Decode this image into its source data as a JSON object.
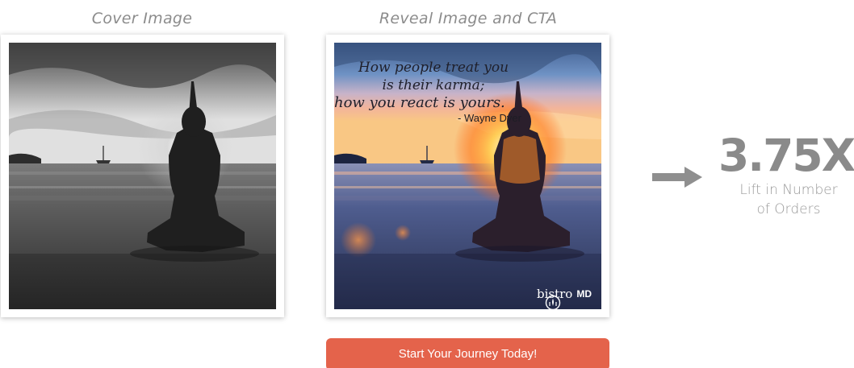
{
  "captions": {
    "cover": "Cover Image",
    "reveal": "Reveal Image and CTA"
  },
  "quote": {
    "line1": "How people treat you",
    "line2": "is their karma;",
    "line3": "how you react is yours.",
    "author": "- Wayne Dyer"
  },
  "brand": {
    "name_prefix": "bistro",
    "name_suffix": "MD",
    "icon": "bistromd-logo-icon"
  },
  "cta": {
    "label": "Start Your Journey Today!",
    "color": "#e4634b"
  },
  "metric": {
    "value": "3.75X",
    "label_line1": "Lift in Number",
    "label_line2": "of Orders",
    "color": "#8a8a8a"
  },
  "arrow": {
    "icon": "arrow-right-icon",
    "color": "#8f8f8f"
  }
}
